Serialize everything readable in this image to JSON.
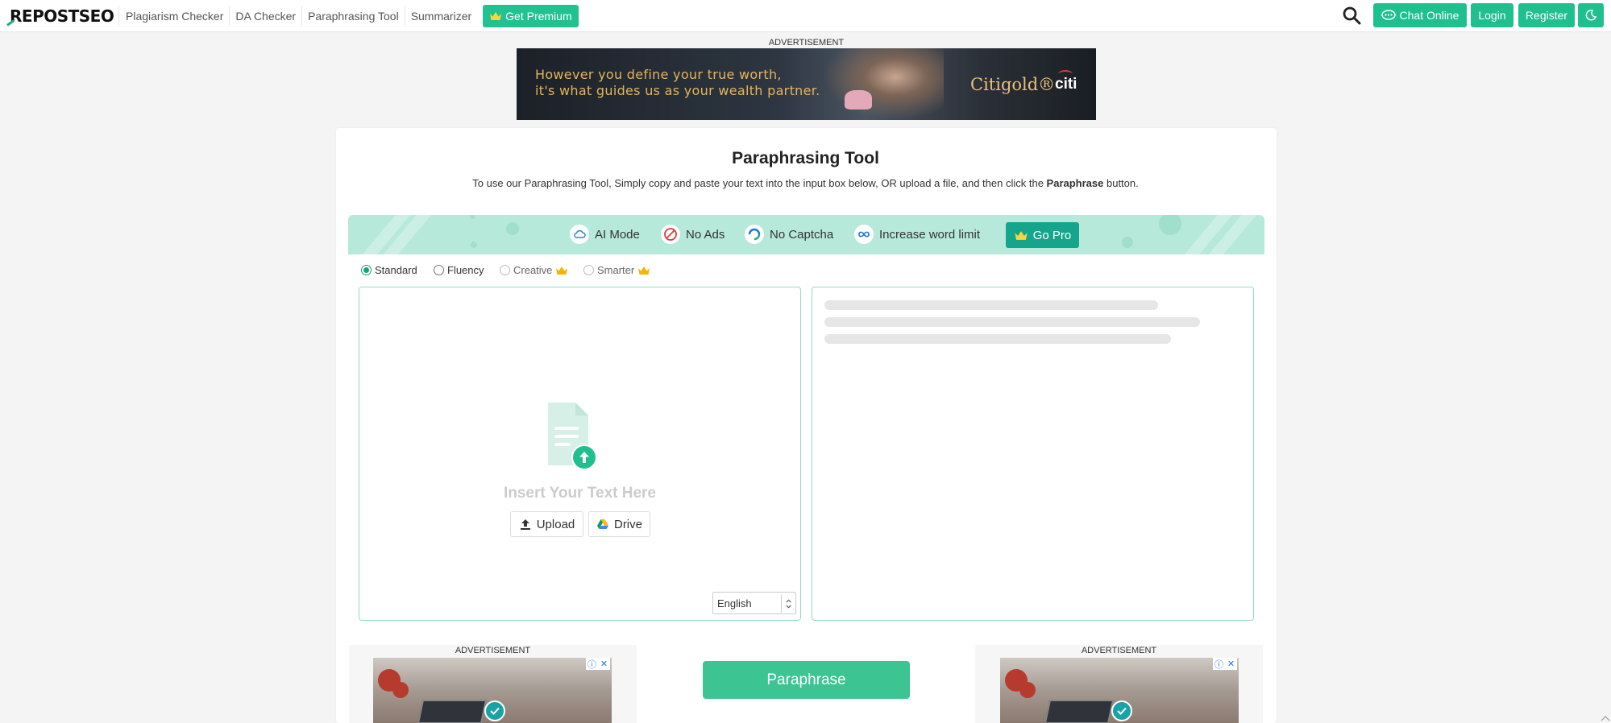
{
  "header": {
    "logo_text": "REPOSTSEO",
    "nav": [
      "Plagiarism Checker",
      "DA Checker",
      "Paraphrasing Tool",
      "Summarizer"
    ],
    "premium_label": "Get Premium",
    "chat_label": "Chat Online",
    "login_label": "Login",
    "register_label": "Register"
  },
  "ads": {
    "label": "ADVERTISEMENT",
    "top_line1": "However you define your true worth,",
    "top_line2": "it's what guides us as your wealth partner.",
    "top_brand": "Citigold®",
    "top_logo": "citi"
  },
  "tool": {
    "title": "Paraphrasing Tool",
    "subtitle_before": "To use our Paraphrasing Tool, Simply copy and paste your text into the input box below, OR upload a file, and then click the ",
    "subtitle_bold": "Paraphrase",
    "subtitle_after": " button."
  },
  "features": {
    "items": [
      "AI Mode",
      "No Ads",
      "No Captcha",
      "Increase word limit"
    ],
    "go_pro": "Go Pro"
  },
  "modes": {
    "options": [
      "Standard",
      "Fluency",
      "Creative",
      "Smarter"
    ],
    "selected": "Standard"
  },
  "input": {
    "placeholder": "Insert Your Text Here",
    "upload_label": "Upload",
    "drive_label": "Drive",
    "language": "English"
  },
  "actions": {
    "paraphrase_label": "Paraphrase"
  },
  "colors": {
    "accent": "#1fbf8e",
    "feature_bg": "#b7e9db",
    "go_pro": "#14a58c"
  }
}
